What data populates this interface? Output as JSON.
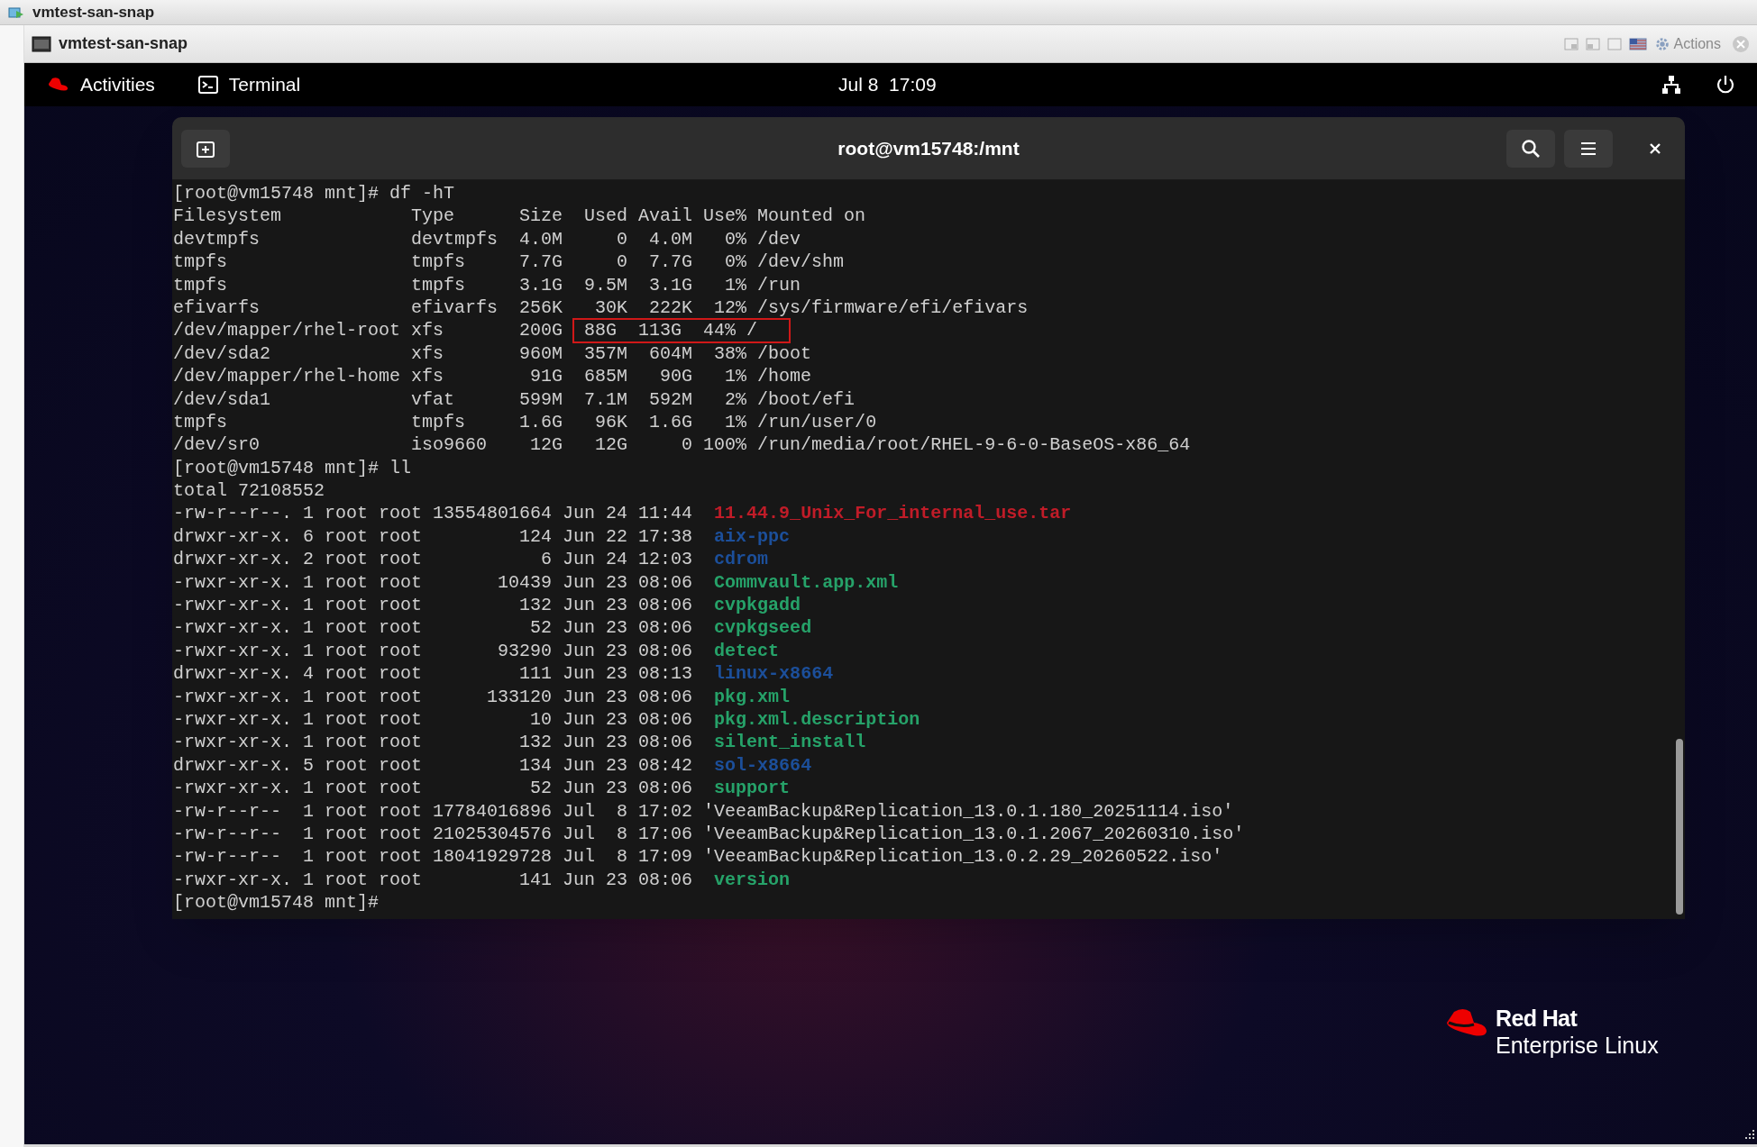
{
  "host_window": {
    "title": "vmtest-san-snap"
  },
  "vm_window": {
    "title": "vmtest-san-snap",
    "actions_label": "Actions"
  },
  "top_bar": {
    "activities": "Activities",
    "app": "Terminal",
    "clock": "Jul 8  17:09"
  },
  "terminal": {
    "title": "root@vm15748:/mnt",
    "lines": [
      {
        "segments": [
          {
            "kind": "plain",
            "text": "[root@vm15748 mnt]# df -hT"
          }
        ]
      },
      {
        "segments": [
          {
            "kind": "plain",
            "text": "Filesystem            Type      Size  Used Avail Use% Mounted on"
          }
        ]
      },
      {
        "segments": [
          {
            "kind": "plain",
            "text": "devtmpfs              devtmpfs  4.0M     0  4.0M   0% /dev"
          }
        ]
      },
      {
        "segments": [
          {
            "kind": "plain",
            "text": "tmpfs                 tmpfs     7.7G     0  7.7G   0% /dev/shm"
          }
        ]
      },
      {
        "segments": [
          {
            "kind": "plain",
            "text": "tmpfs                 tmpfs     3.1G  9.5M  3.1G   1% /run"
          }
        ]
      },
      {
        "segments": [
          {
            "kind": "plain",
            "text": "efivarfs              efivarfs  256K   30K  222K  12% /sys/firmware/efi/efivars"
          }
        ]
      },
      {
        "segments": [
          {
            "kind": "plain",
            "text": "/dev/mapper/rhel-root xfs       200G "
          },
          {
            "kind": "boxed",
            "text": " 88G  113G  44% /"
          }
        ]
      },
      {
        "segments": [
          {
            "kind": "plain",
            "text": "/dev/sda2             xfs       960M  357M  604M  38% /boot"
          }
        ]
      },
      {
        "segments": [
          {
            "kind": "plain",
            "text": "/dev/mapper/rhel-home xfs        91G  685M   90G   1% /home"
          }
        ]
      },
      {
        "segments": [
          {
            "kind": "plain",
            "text": "/dev/sda1             vfat      599M  7.1M  592M   2% /boot/efi"
          }
        ]
      },
      {
        "segments": [
          {
            "kind": "plain",
            "text": "tmpfs                 tmpfs     1.6G   96K  1.6G   1% /run/user/0"
          }
        ]
      },
      {
        "segments": [
          {
            "kind": "plain",
            "text": "/dev/sr0              iso9660    12G   12G     0 100% /run/media/root/RHEL-9-6-0-BaseOS-x86_64"
          }
        ]
      },
      {
        "segments": [
          {
            "kind": "plain",
            "text": "[root@vm15748 mnt]# ll"
          }
        ]
      },
      {
        "segments": [
          {
            "kind": "plain",
            "text": "total 72108552"
          }
        ]
      },
      {
        "segments": [
          {
            "kind": "plain",
            "text": "-rw-r--r--. 1 root root 13554801664 Jun 24 11:44  "
          },
          {
            "kind": "archive",
            "text": "11.44.9_Unix_For_internal_use.tar"
          }
        ]
      },
      {
        "segments": [
          {
            "kind": "plain",
            "text": "drwxr-xr-x. 6 root root         124 Jun 22 17:38  "
          },
          {
            "kind": "directory",
            "text": "aix-ppc"
          }
        ]
      },
      {
        "segments": [
          {
            "kind": "plain",
            "text": "drwxr-xr-x. 2 root root           6 Jun 24 12:03  "
          },
          {
            "kind": "directory",
            "text": "cdrom"
          }
        ]
      },
      {
        "segments": [
          {
            "kind": "plain",
            "text": "-rwxr-xr-x. 1 root root       10439 Jun 23 08:06  "
          },
          {
            "kind": "executable",
            "text": "Commvault.app.xml"
          }
        ]
      },
      {
        "segments": [
          {
            "kind": "plain",
            "text": "-rwxr-xr-x. 1 root root         132 Jun 23 08:06  "
          },
          {
            "kind": "executable",
            "text": "cvpkgadd"
          }
        ]
      },
      {
        "segments": [
          {
            "kind": "plain",
            "text": "-rwxr-xr-x. 1 root root          52 Jun 23 08:06  "
          },
          {
            "kind": "executable",
            "text": "cvpkgseed"
          }
        ]
      },
      {
        "segments": [
          {
            "kind": "plain",
            "text": "-rwxr-xr-x. 1 root root       93290 Jun 23 08:06  "
          },
          {
            "kind": "executable",
            "text": "detect"
          }
        ]
      },
      {
        "segments": [
          {
            "kind": "plain",
            "text": "drwxr-xr-x. 4 root root         111 Jun 23 08:13  "
          },
          {
            "kind": "directory",
            "text": "linux-x8664"
          }
        ]
      },
      {
        "segments": [
          {
            "kind": "plain",
            "text": "-rwxr-xr-x. 1 root root      133120 Jun 23 08:06  "
          },
          {
            "kind": "executable",
            "text": "pkg.xml"
          }
        ]
      },
      {
        "segments": [
          {
            "kind": "plain",
            "text": "-rwxr-xr-x. 1 root root          10 Jun 23 08:06  "
          },
          {
            "kind": "executable",
            "text": "pkg.xml.description"
          }
        ]
      },
      {
        "segments": [
          {
            "kind": "plain",
            "text": "-rwxr-xr-x. 1 root root         132 Jun 23 08:06  "
          },
          {
            "kind": "executable",
            "text": "silent_install"
          }
        ]
      },
      {
        "segments": [
          {
            "kind": "plain",
            "text": "drwxr-xr-x. 5 root root         134 Jun 23 08:42  "
          },
          {
            "kind": "directory",
            "text": "sol-x8664"
          }
        ]
      },
      {
        "segments": [
          {
            "kind": "plain",
            "text": "-rwxr-xr-x. 1 root root          52 Jun 23 08:06  "
          },
          {
            "kind": "executable",
            "text": "support"
          }
        ]
      },
      {
        "segments": [
          {
            "kind": "plain",
            "text": "-rw-r--r--  1 root root 17784016896 Jul  8 17:02 'VeeamBackup&Replication_13.0.1.180_20251114.iso'"
          }
        ]
      },
      {
        "segments": [
          {
            "kind": "plain",
            "text": "-rw-r--r--  1 root root 21025304576 Jul  8 17:06 'VeeamBackup&Replication_13.0.1.2067_20260310.iso'"
          }
        ]
      },
      {
        "segments": [
          {
            "kind": "plain",
            "text": "-rw-r--r--  1 root root 18041929728 Jul  8 17:09 'VeeamBackup&Replication_13.0.2.29_20260522.iso'"
          }
        ]
      },
      {
        "segments": [
          {
            "kind": "plain",
            "text": "-rwxr-xr-x. 1 root root         141 Jun 23 08:06  "
          },
          {
            "kind": "executable",
            "text": "version"
          }
        ]
      },
      {
        "segments": [
          {
            "kind": "plain",
            "text": "[root@vm15748 mnt]#"
          }
        ]
      }
    ]
  },
  "wallpaper_logo": {
    "line_1": "Red Hat",
    "line_2": "Enterprise Linux"
  }
}
